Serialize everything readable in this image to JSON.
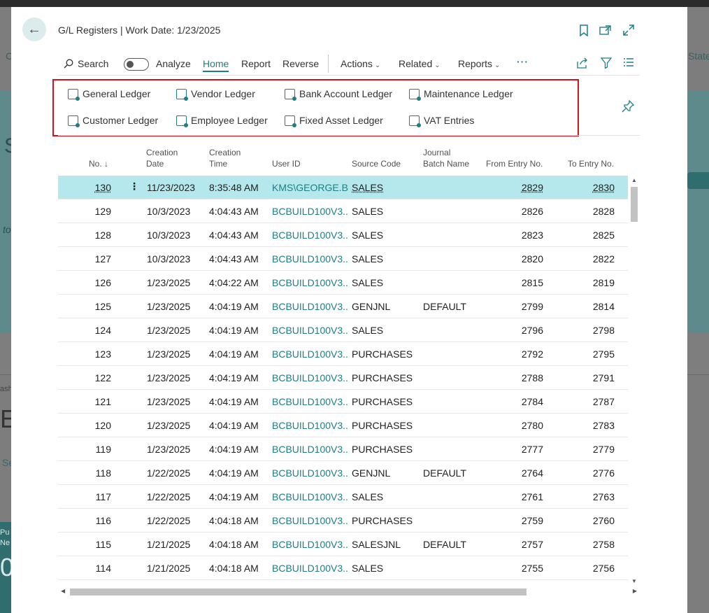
{
  "header": {
    "title": "G/L Registers | Work Date: 1/23/2025"
  },
  "actionbar": {
    "search_label": "Search",
    "analyze_label": "Analyze",
    "home_label": "Home",
    "report_label": "Report",
    "reverse_label": "Reverse",
    "actions_label": "Actions",
    "related_label": "Related",
    "reports_label": "Reports",
    "more_label": "···"
  },
  "promoted": {
    "general_ledger": "General Ledger",
    "vendor_ledger": "Vendor Ledger",
    "bank_account_ledger": "Bank Account Ledger",
    "maintenance_ledger": "Maintenance Ledger",
    "customer_ledger": "Customer Ledger",
    "employee_ledger": "Employee Ledger",
    "fixed_asset_ledger": "Fixed Asset Ledger",
    "vat_entries": "VAT Entries"
  },
  "columns": {
    "no": "No. ↓",
    "creation_date_1": "Creation",
    "creation_date_2": "Date",
    "creation_time_1": "Creation",
    "creation_time_2": "Time",
    "user_id": "User ID",
    "source_code": "Source Code",
    "journal_batch_1": "Journal",
    "journal_batch_2": "Batch Name",
    "from_entry": "From Entry No.",
    "to_entry": "To Entry No."
  },
  "rows": [
    {
      "no": "130",
      "date": "11/23/2023",
      "time": "8:35:48 AM",
      "user": "KMS\\GEORGE.B...",
      "source": "SALES",
      "batch": "",
      "from": "2829",
      "to": "2830"
    },
    {
      "no": "129",
      "date": "10/3/2023",
      "time": "4:04:43 AM",
      "user": "BCBUILD100V3...",
      "source": "SALES",
      "batch": "",
      "from": "2826",
      "to": "2828"
    },
    {
      "no": "128",
      "date": "10/3/2023",
      "time": "4:04:43 AM",
      "user": "BCBUILD100V3...",
      "source": "SALES",
      "batch": "",
      "from": "2823",
      "to": "2825"
    },
    {
      "no": "127",
      "date": "10/3/2023",
      "time": "4:04:43 AM",
      "user": "BCBUILD100V3...",
      "source": "SALES",
      "batch": "",
      "from": "2820",
      "to": "2822"
    },
    {
      "no": "126",
      "date": "1/23/2025",
      "time": "4:04:22 AM",
      "user": "BCBUILD100V3...",
      "source": "SALES",
      "batch": "",
      "from": "2815",
      "to": "2819"
    },
    {
      "no": "125",
      "date": "1/23/2025",
      "time": "4:04:19 AM",
      "user": "BCBUILD100V3...",
      "source": "GENJNL",
      "batch": "DEFAULT",
      "from": "2799",
      "to": "2814"
    },
    {
      "no": "124",
      "date": "1/23/2025",
      "time": "4:04:19 AM",
      "user": "BCBUILD100V3...",
      "source": "SALES",
      "batch": "",
      "from": "2796",
      "to": "2798"
    },
    {
      "no": "123",
      "date": "1/23/2025",
      "time": "4:04:19 AM",
      "user": "BCBUILD100V3...",
      "source": "PURCHASES",
      "batch": "",
      "from": "2792",
      "to": "2795"
    },
    {
      "no": "122",
      "date": "1/23/2025",
      "time": "4:04:19 AM",
      "user": "BCBUILD100V3...",
      "source": "PURCHASES",
      "batch": "",
      "from": "2788",
      "to": "2791"
    },
    {
      "no": "121",
      "date": "1/23/2025",
      "time": "4:04:19 AM",
      "user": "BCBUILD100V3...",
      "source": "PURCHASES",
      "batch": "",
      "from": "2784",
      "to": "2787"
    },
    {
      "no": "120",
      "date": "1/23/2025",
      "time": "4:04:19 AM",
      "user": "BCBUILD100V3...",
      "source": "PURCHASES",
      "batch": "",
      "from": "2780",
      "to": "2783"
    },
    {
      "no": "119",
      "date": "1/23/2025",
      "time": "4:04:19 AM",
      "user": "BCBUILD100V3...",
      "source": "PURCHASES",
      "batch": "",
      "from": "2777",
      "to": "2779"
    },
    {
      "no": "118",
      "date": "1/22/2025",
      "time": "4:04:19 AM",
      "user": "BCBUILD100V3...",
      "source": "GENJNL",
      "batch": "DEFAULT",
      "from": "2764",
      "to": "2776"
    },
    {
      "no": "117",
      "date": "1/22/2025",
      "time": "4:04:19 AM",
      "user": "BCBUILD100V3...",
      "source": "SALES",
      "batch": "",
      "from": "2761",
      "to": "2763"
    },
    {
      "no": "116",
      "date": "1/22/2025",
      "time": "4:04:18 AM",
      "user": "BCBUILD100V3...",
      "source": "PURCHASES",
      "batch": "",
      "from": "2759",
      "to": "2760"
    },
    {
      "no": "115",
      "date": "1/21/2025",
      "time": "4:04:18 AM",
      "user": "BCBUILD100V3...",
      "source": "SALESJNL",
      "batch": "DEFAULT",
      "from": "2757",
      "to": "2758"
    },
    {
      "no": "114",
      "date": "1/21/2025",
      "time": "4:04:18 AM",
      "user": "BCBUILD100V3...",
      "source": "SALES",
      "batch": "",
      "from": "2755",
      "to": "2756"
    }
  ],
  "background": {
    "frag_state": "State",
    "frag_c": "C",
    "frag_s": "S",
    "frag_to": "to",
    "frag_ash": "ash",
    "frag_e": "E",
    "frag_se": "Se",
    "frag_pu": "Pu",
    "frag_ne": "Ne",
    "frag_0": "0"
  },
  "colors": {
    "accent": "#1f7e84",
    "selected_row": "#b4e8ec",
    "promoted_border": "#d4121e"
  }
}
